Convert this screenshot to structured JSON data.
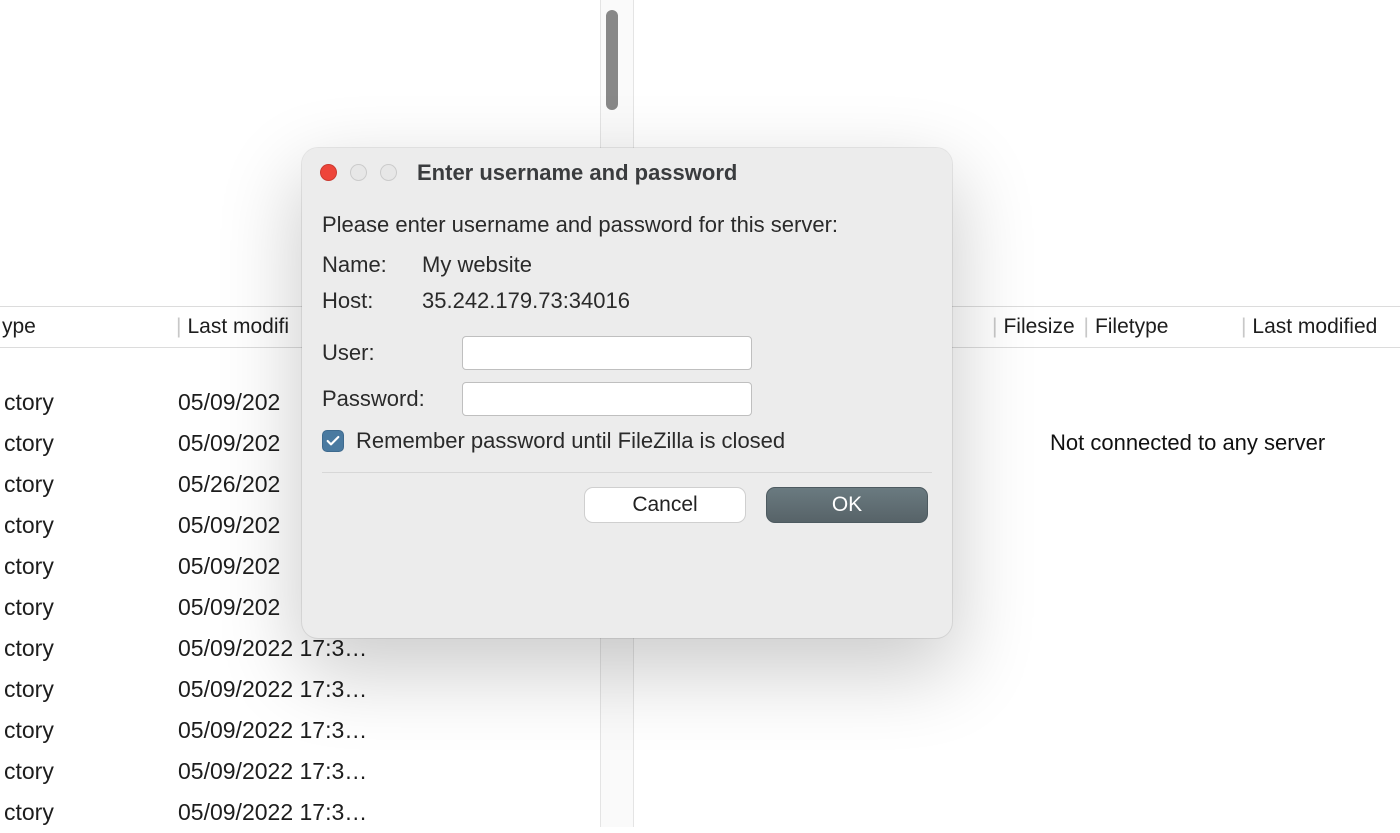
{
  "dialog": {
    "title": "Enter username and password",
    "prompt": "Please enter username and password for this server:",
    "name_label": "Name:",
    "name_value": "My website",
    "host_label": "Host:",
    "host_value": "35.242.179.73:34016",
    "user_label": "User:",
    "user_value": "",
    "password_label": "Password:",
    "password_value": "",
    "remember_label": "Remember password until FileZilla is closed",
    "remember_checked": true,
    "cancel_label": "Cancel",
    "ok_label": "OK"
  },
  "columns_left": {
    "type": "ype",
    "last_modified": "Last modifi"
  },
  "columns_right": {
    "filesize": "Filesize",
    "filetype": "Filetype",
    "last_modified": "Last modified"
  },
  "remote_message": "Not connected to any server",
  "rows": [
    {
      "type": "ctory",
      "lastmod": "05/09/202"
    },
    {
      "type": "ctory",
      "lastmod": "05/09/202"
    },
    {
      "type": "ctory",
      "lastmod": "05/26/202"
    },
    {
      "type": "ctory",
      "lastmod": "05/09/202"
    },
    {
      "type": "ctory",
      "lastmod": "05/09/202"
    },
    {
      "type": "ctory",
      "lastmod": "05/09/202"
    },
    {
      "type": "ctory",
      "lastmod": "05/09/2022 17:3…"
    },
    {
      "type": "ctory",
      "lastmod": "05/09/2022 17:3…"
    },
    {
      "type": "ctory",
      "lastmod": "05/09/2022 17:3…"
    },
    {
      "type": "ctory",
      "lastmod": "05/09/2022 17:3…"
    },
    {
      "type": "ctory",
      "lastmod": "05/09/2022 17:3…"
    }
  ]
}
